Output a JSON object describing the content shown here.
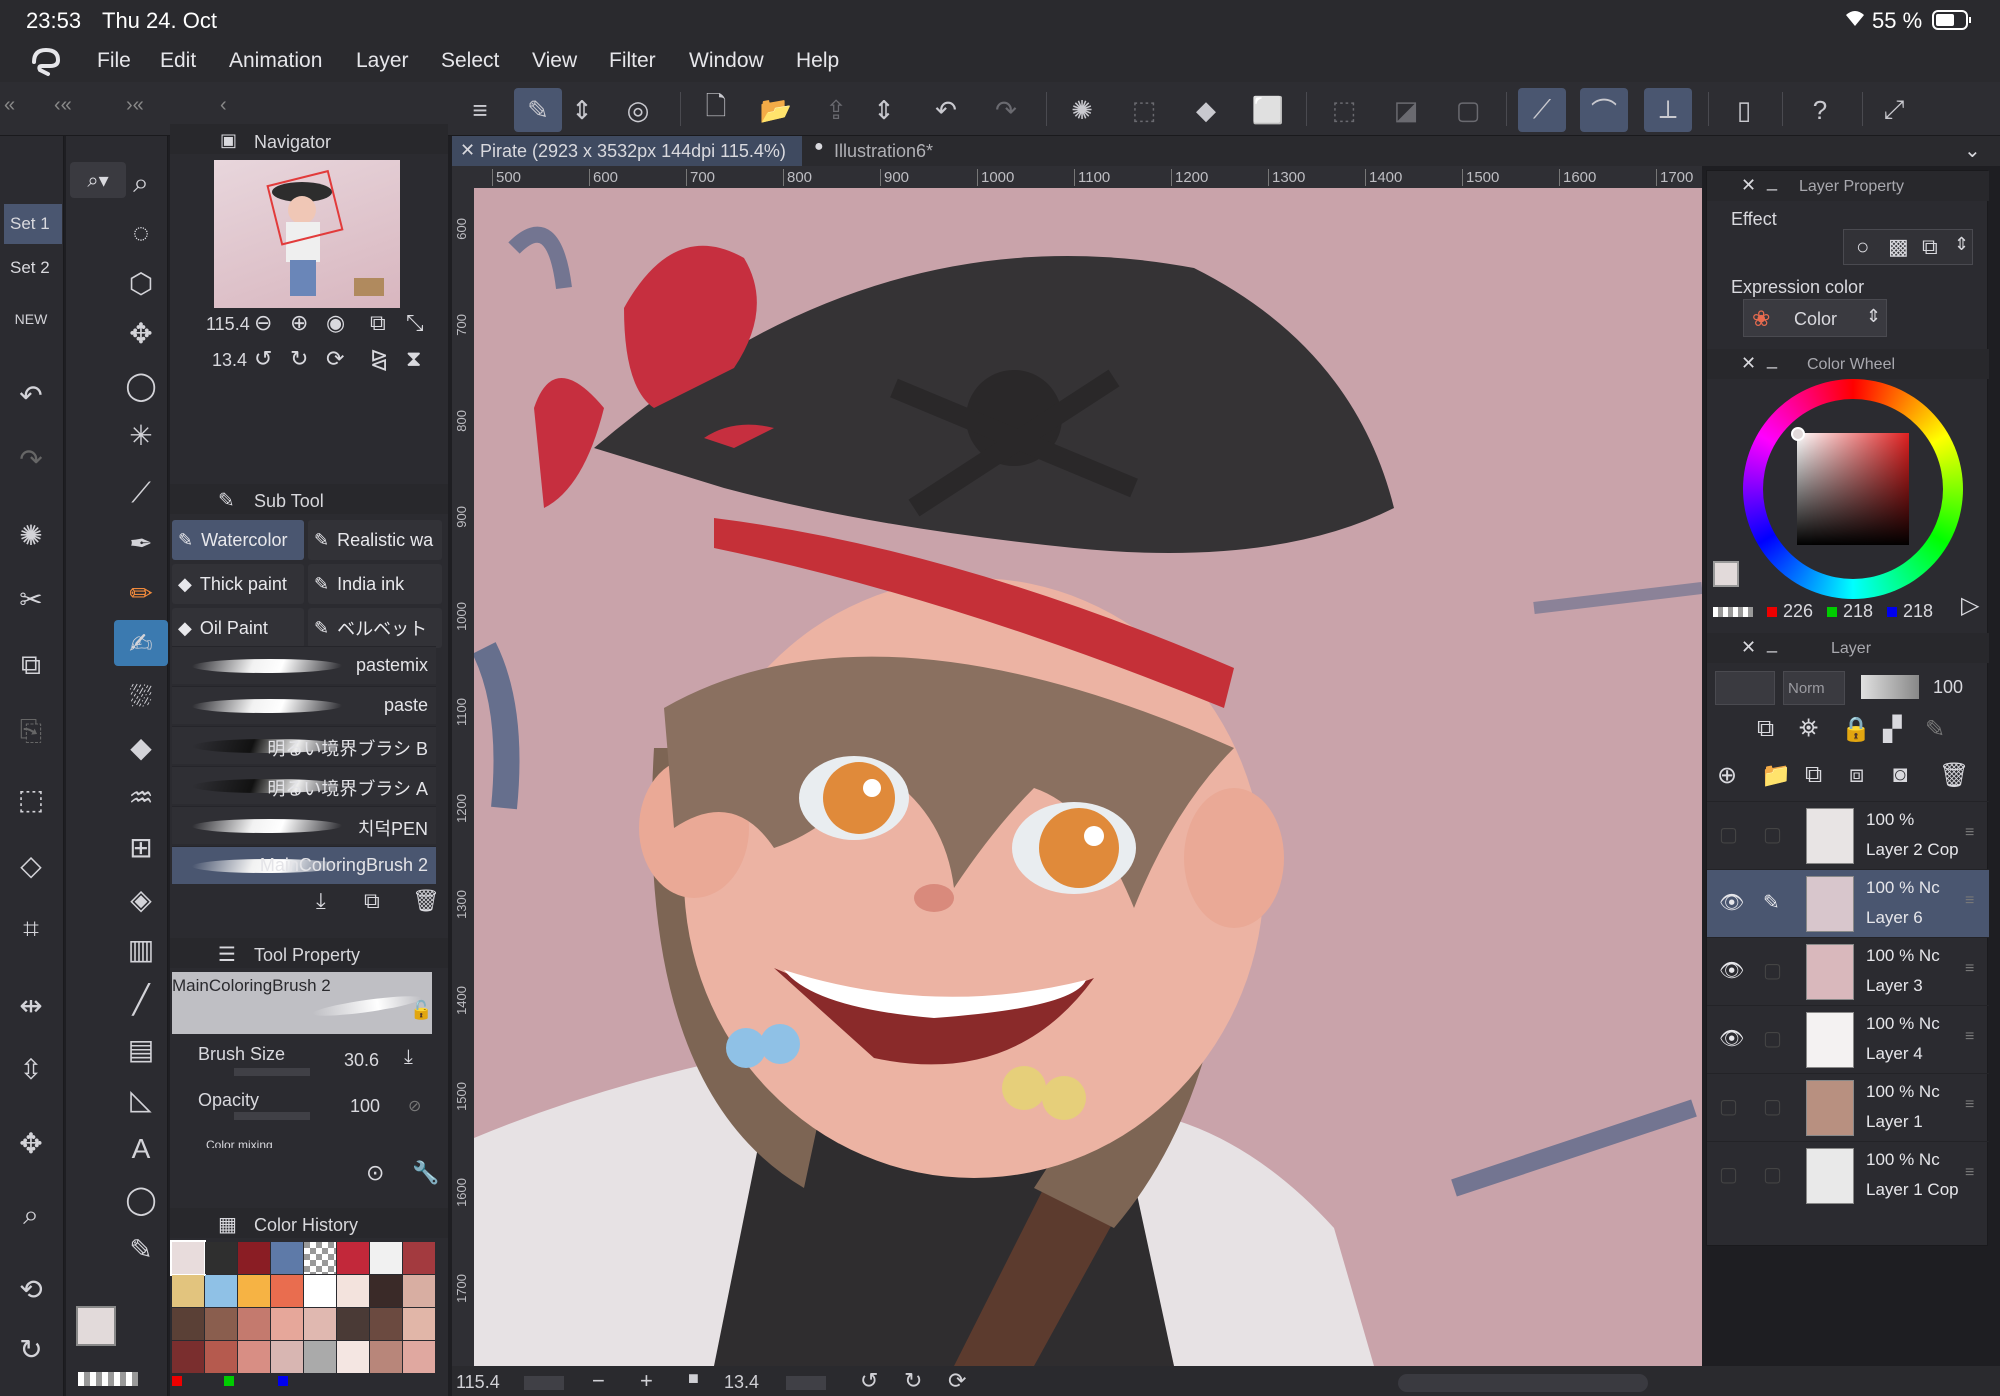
{
  "status": {
    "time": "23:53",
    "date": "Thu 24. Oct",
    "battery": "55 %"
  },
  "menu": {
    "items": [
      "File",
      "Edit",
      "Animation",
      "Layer",
      "Select",
      "View",
      "Filter",
      "Window",
      "Help"
    ]
  },
  "tabs": [
    {
      "label": "Pirate (2923 x 3532px 144dpi 115.4%)",
      "active": true
    },
    {
      "label": "Illustration6*",
      "active": false
    }
  ],
  "left": {
    "sets": [
      "Set 1",
      "Set 2"
    ]
  },
  "navigator": {
    "title": "Navigator",
    "zoom": "115.4",
    "rotation": "13.4"
  },
  "subtool": {
    "title": "Sub Tool",
    "presets": [
      "Watercolor",
      "Realistic wa",
      "Thick paint",
      "India ink",
      "Oil Paint",
      "ベルベット"
    ],
    "brushes": [
      "pastemix",
      "paste",
      "明るい境界ブラシ B",
      "明るい境界ブラシ A",
      "치덕PEN",
      "MainColoringBrush 2"
    ]
  },
  "toolproperty": {
    "title": "Tool Property",
    "brush_name": "MainColoringBrush 2",
    "brush_size_label": "Brush Size",
    "brush_size": "30.6",
    "opacity_label": "Opacity",
    "opacity": "100",
    "color_mixing": "Color mixing"
  },
  "colorhistory": {
    "title": "Color History",
    "colors": [
      "#e8dcdc",
      "#2f2f2f",
      "#8a1d24",
      "#5e7aa8",
      "#checker",
      "#c2283a",
      "#f1f1f1",
      "#a33a3f",
      "#e2c47e",
      "#8fc1e6",
      "#f6b344",
      "#e96d4f",
      "#ffffff",
      "#f3e3dd",
      "#3a2a28",
      "#d8aea2",
      "#5a4036",
      "#8a5e4e",
      "#c47a6e",
      "#e6a79a",
      "#e0b8b0",
      "#4a3a36",
      "#6b4a40",
      "#e1b6a8",
      "#7a2e2e",
      "#b55a4e",
      "#d88e84",
      "#d8b6b2",
      "#aaaaaa",
      "#f4e6e2",
      "#b8867a",
      "#e0a8a0"
    ]
  },
  "rulers": {
    "top": [
      "500",
      "600",
      "700",
      "800",
      "900",
      "1000",
      "1100",
      "1200",
      "1300",
      "1400",
      "1500",
      "1600",
      "1700"
    ],
    "left": [
      "600",
      "700",
      "800",
      "900",
      "1000",
      "1100",
      "1200",
      "1300",
      "1400",
      "1500",
      "1600",
      "1700"
    ]
  },
  "layerproperty": {
    "title": "Layer Property",
    "effect": "Effect",
    "expression_color": "Expression color",
    "color_mode": "Color"
  },
  "colorwheel": {
    "title": "Color Wheel",
    "r": "226",
    "g": "218",
    "b": "218"
  },
  "layers": {
    "title": "Layer",
    "blend": "Norm",
    "opacity": "100",
    "items": [
      {
        "pct": "100 %",
        "name": "Layer 2 Cop",
        "visible": false,
        "selected": false,
        "blend": ""
      },
      {
        "pct": "100 %",
        "name": "Layer 6",
        "visible": true,
        "selected": true,
        "blend": "Nc"
      },
      {
        "pct": "100 %",
        "name": "Layer 3",
        "visible": true,
        "selected": false,
        "blend": "Nc"
      },
      {
        "pct": "100 %",
        "name": "Layer 4",
        "visible": true,
        "selected": false,
        "blend": "Nc"
      },
      {
        "pct": "100 %",
        "name": "Layer 1",
        "visible": false,
        "selected": false,
        "blend": "Nc"
      },
      {
        "pct": "100 %",
        "name": "Layer 1 Cop",
        "visible": false,
        "selected": false,
        "blend": "Nc"
      }
    ]
  },
  "bottombar": {
    "zoom": "115.4",
    "rotation": "13.4"
  }
}
